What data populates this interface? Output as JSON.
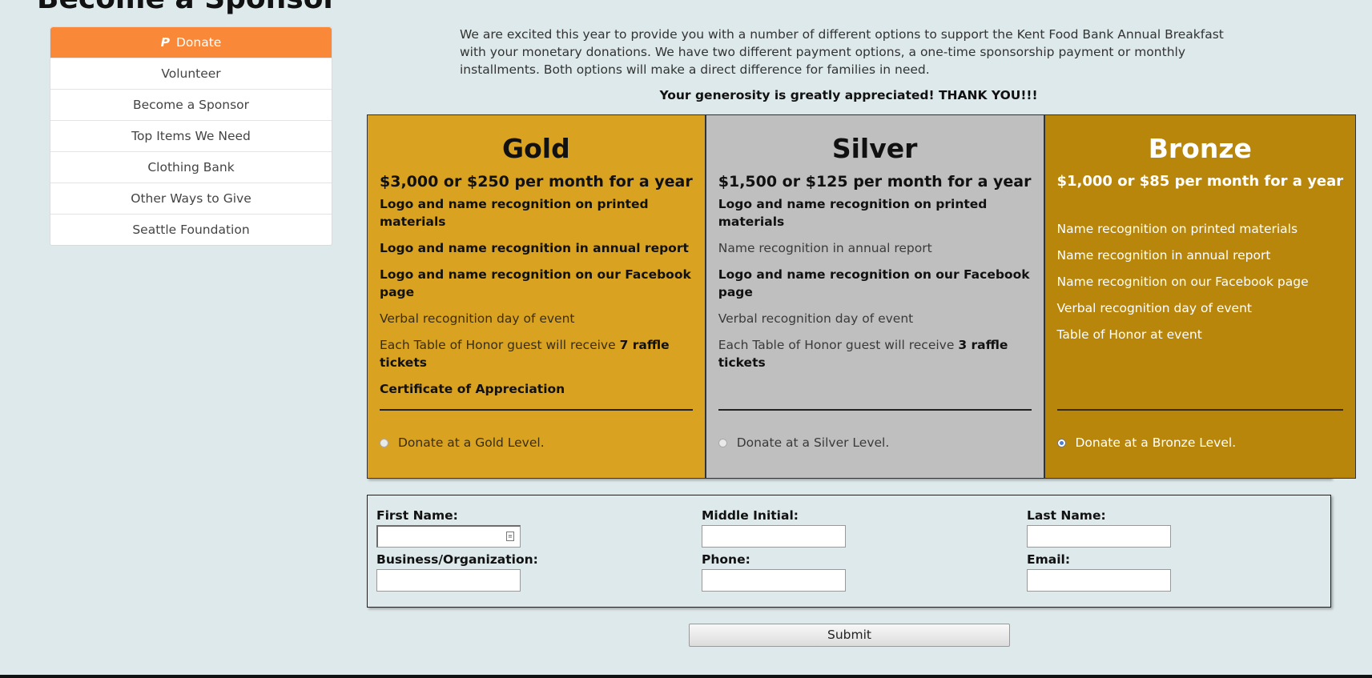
{
  "page": {
    "title": "Become a Sponsor"
  },
  "sidebar": {
    "items": [
      {
        "label": "Donate",
        "icon": "paypal-icon",
        "active": true
      },
      {
        "label": "Volunteer"
      },
      {
        "label": "Become a Sponsor"
      },
      {
        "label": "Top Items We Need"
      },
      {
        "label": "Clothing Bank"
      },
      {
        "label": "Other Ways to Give"
      },
      {
        "label": "Seattle Foundation"
      }
    ]
  },
  "intro": {
    "text": "We are excited this year to provide you with a number of different options to support the Kent Food Bank Annual Breakfast with your monetary donations. We have two different payment options, a one-time sponsorship payment or monthly installments. Both options will make a direct difference for families in need.",
    "thanks": "Your generosity is greatly appreciated! THANK YOU!!!"
  },
  "tiers": [
    {
      "name": "Gold",
      "price": "$3,000 or $250 per month for a year",
      "color": "#d9a321",
      "benefits": [
        "Logo and name recognition on printed materials",
        "Logo and name recognition in annual report",
        "Logo and name recognition on our Facebook page",
        "Verbal recognition day of event",
        {
          "prefix": "Each Table of Honor guest will receive ",
          "bold": "7 raffle tickets"
        },
        "Certificate of Appreciation"
      ],
      "radio_label": "Donate at a Gold Level.",
      "selected": false
    },
    {
      "name": "Silver",
      "price": "$1,500 or $125 per month for a year",
      "color": "#bfbfbf",
      "benefits": [
        "Logo and name recognition on printed materials",
        "Name recognition in annual report",
        "Logo and name recognition on our Facebook page",
        "Verbal recognition day of event",
        {
          "prefix": "Each Table of Honor guest will receive ",
          "bold": "3 raffle tickets"
        }
      ],
      "radio_label": "Donate at a Silver Level.",
      "selected": false
    },
    {
      "name": "Bronze",
      "price": "$1,000 or $85 per month for a year",
      "color": "#b8860b",
      "benefits": [
        "Name recognition on printed materials",
        "Name recognition in annual report",
        "Name recognition on our Facebook page",
        "Verbal recognition day of event",
        "Table of Honor at event"
      ],
      "radio_label": "Donate at a Bronze Level.",
      "selected": true
    }
  ],
  "form": {
    "first_name": {
      "label": "First Name:",
      "value": ""
    },
    "middle_initial": {
      "label": "Middle Initial:",
      "value": ""
    },
    "last_name": {
      "label": "Last Name:",
      "value": ""
    },
    "business": {
      "label": "Business/Organization:",
      "value": ""
    },
    "phone": {
      "label": "Phone:",
      "value": ""
    },
    "email": {
      "label": "Email:",
      "value": ""
    },
    "submit_label": "Submit"
  }
}
